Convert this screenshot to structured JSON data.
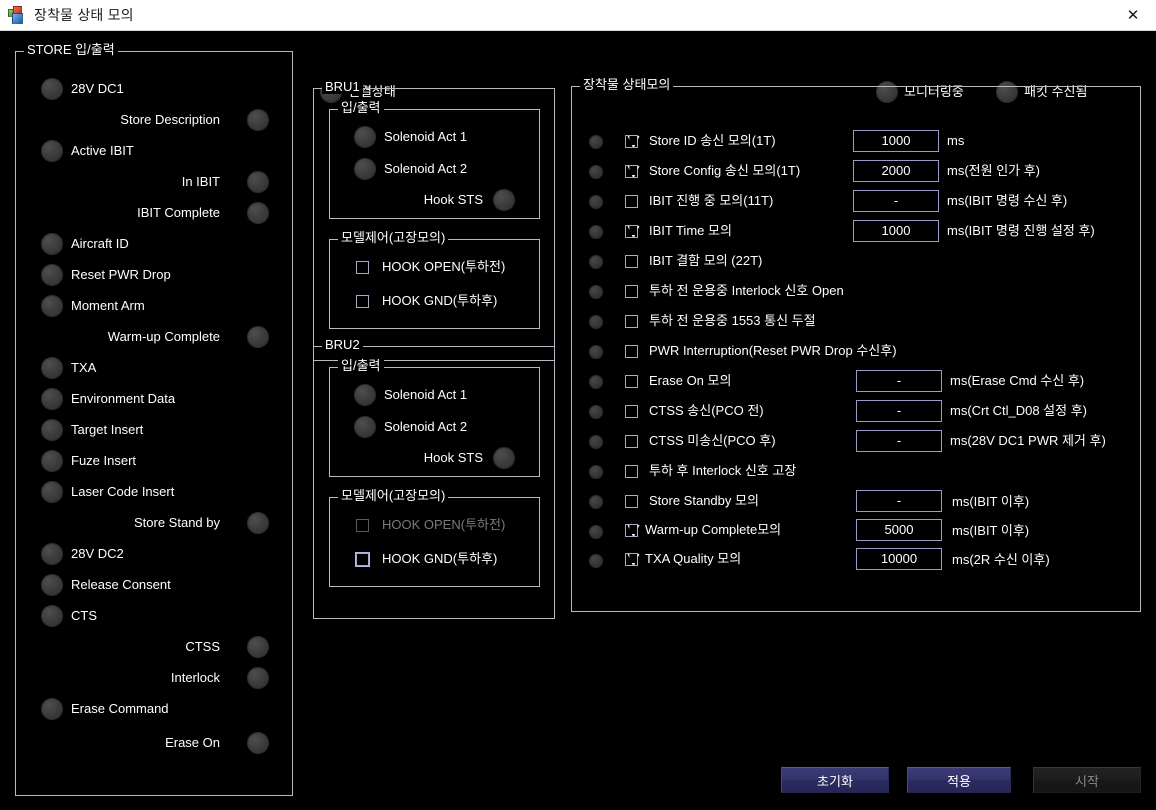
{
  "window": {
    "title": "장착물 상태 모의",
    "icon": "app-blocks-icon",
    "close_label": "✕"
  },
  "top_indicators": [
    {
      "label": "연결상태"
    },
    {
      "label": "모니터링중"
    },
    {
      "label": "패킷 수신됨"
    }
  ],
  "store_io": {
    "title": "STORE 입/출력",
    "items": [
      {
        "label": "28V DC1",
        "align": "left"
      },
      {
        "label": "Store Description",
        "align": "right"
      },
      {
        "label": "Active IBIT",
        "align": "left"
      },
      {
        "label": "In IBIT",
        "align": "right"
      },
      {
        "label": "IBIT Complete",
        "align": "right"
      },
      {
        "label": "Aircraft ID",
        "align": "left"
      },
      {
        "label": "Reset PWR Drop",
        "align": "left"
      },
      {
        "label": "Moment Arm",
        "align": "left"
      },
      {
        "label": "Warm-up Complete",
        "align": "right"
      },
      {
        "label": "TXA",
        "align": "left"
      },
      {
        "label": "Environment Data",
        "align": "left"
      },
      {
        "label": "Target Insert",
        "align": "left"
      },
      {
        "label": "Fuze Insert",
        "align": "left"
      },
      {
        "label": "Laser Code Insert",
        "align": "left"
      },
      {
        "label": "Store Stand by",
        "align": "right"
      },
      {
        "label": "28V DC2",
        "align": "left"
      },
      {
        "label": "Release Consent",
        "align": "left"
      },
      {
        "label": "CTS",
        "align": "left"
      },
      {
        "label": "CTSS",
        "align": "right"
      },
      {
        "label": "Interlock",
        "align": "right"
      },
      {
        "label": "Erase Command",
        "align": "left"
      },
      {
        "label": "Erase On",
        "align": "right"
      }
    ]
  },
  "bru1": {
    "title": "BRU1",
    "io": {
      "title": "입/출력",
      "items": [
        {
          "label": "Solenoid Act 1",
          "align": "left"
        },
        {
          "label": "Solenoid Act 2",
          "align": "left"
        },
        {
          "label": "Hook STS",
          "align": "right"
        }
      ]
    },
    "model": {
      "title": "모델제어(고장모의)",
      "items": [
        {
          "label": "HOOK OPEN(투하전)",
          "checked": false,
          "disabled": false
        },
        {
          "label": "HOOK GND(투하후)",
          "checked": false,
          "disabled": false
        }
      ]
    }
  },
  "bru2": {
    "title": "BRU2",
    "io": {
      "title": "입/출력",
      "items": [
        {
          "label": "Solenoid Act 1",
          "align": "left"
        },
        {
          "label": "Solenoid Act 2",
          "align": "left"
        },
        {
          "label": "Hook STS",
          "align": "right"
        }
      ]
    },
    "model": {
      "title": "모델제어(고장모의)",
      "items": [
        {
          "label": "HOOK OPEN(투하전)",
          "checked": false,
          "disabled": true
        },
        {
          "label": "HOOK GND(투하후)",
          "checked": false,
          "disabled": false
        }
      ]
    }
  },
  "store_sim": {
    "title": "장착물 상태모의",
    "rows": [
      {
        "label": "Store ID 송신 모의(1T)",
        "checked": true,
        "value": "1000",
        "unit": "ms"
      },
      {
        "label": "Store Config 송신 모의(1T)",
        "checked": true,
        "value": "2000",
        "unit": "ms(전원 인가 후)"
      },
      {
        "label": "IBIT 진행 중 모의(11T)",
        "checked": false,
        "value": "-",
        "unit": "ms(IBIT 명령 수신 후)"
      },
      {
        "label": "IBIT Time 모의",
        "checked": true,
        "value": "1000",
        "unit": "ms(IBIT 명령 진행 설정 후)"
      },
      {
        "label": "IBIT 결함 모의 (22T)",
        "checked": false,
        "value": null,
        "unit": null
      },
      {
        "label": "투하 전 운용중  Interlock 신호 Open",
        "checked": false,
        "value": null,
        "unit": null
      },
      {
        "label": "투하 전 운용중 1553 통신 두절",
        "checked": false,
        "value": null,
        "unit": null
      },
      {
        "label": "PWR Interruption(Reset PWR Drop 수신후)",
        "checked": false,
        "value": null,
        "unit": null
      },
      {
        "label": "Erase On 모의",
        "checked": false,
        "value": "-",
        "unit": "ms(Erase Cmd 수신 후)"
      },
      {
        "label": "CTSS 송신(PCO 전)",
        "checked": false,
        "value": "-",
        "unit": "ms(Crt Ctl_D08 설정 후)"
      },
      {
        "label": "CTSS 미송신(PCO 후)",
        "checked": false,
        "value": "-",
        "unit": "ms(28V DC1 PWR 제거 후)"
      },
      {
        "label": "투하 후 Interlock 신호 고장",
        "checked": false,
        "value": null,
        "unit": null
      },
      {
        "label": "Store Standby 모의",
        "checked": false,
        "value": "-",
        "unit": "ms(IBIT 이후)"
      },
      {
        "label": "Warm-up Complete모의",
        "checked": true,
        "value": "5000",
        "unit": "ms(IBIT 이후)"
      },
      {
        "label": " TXA Quality 모의",
        "checked": true,
        "value": "10000",
        "unit": "ms(2R 수신 이후)"
      }
    ]
  },
  "buttons": [
    {
      "label": "초기화",
      "disabled": false
    },
    {
      "label": "적용",
      "disabled": false
    },
    {
      "label": "시작",
      "disabled": true
    }
  ]
}
